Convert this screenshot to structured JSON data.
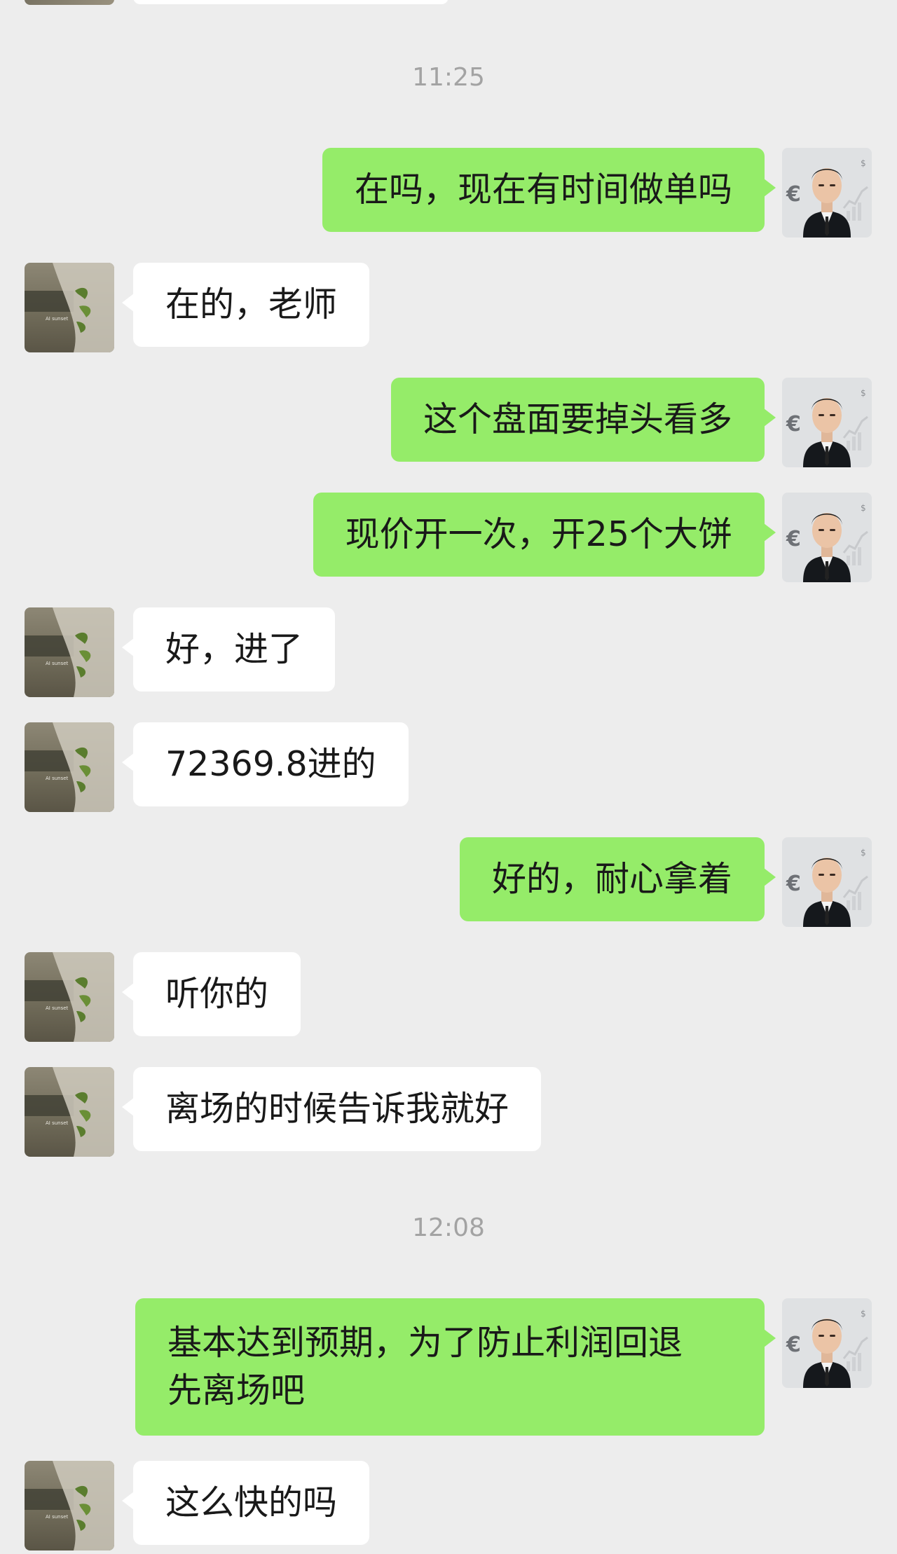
{
  "chat": {
    "timestamps": [
      "11:25",
      "12:08"
    ],
    "avatars": {
      "me": {
        "name": "advisor-avatar",
        "icons": [
          "euro-icon",
          "dollar-icon",
          "chart-icon"
        ],
        "colors": {
          "bg": "#dfe1e3",
          "suit": "#111418"
        }
      },
      "other": {
        "name": "contact-avatar",
        "watermark": "AI sunset",
        "colors": {
          "bg": "#6f6a58",
          "leaf": "#5a7d2e"
        }
      }
    },
    "messages": [
      {
        "from": "me",
        "text": "在吗，现在有时间做单吗"
      },
      {
        "from": "other",
        "text": "在的，老师"
      },
      {
        "from": "me",
        "text": "这个盘面要掉头看多"
      },
      {
        "from": "me",
        "text": "现价开一次，开25个大饼"
      },
      {
        "from": "other",
        "text": "好，进了"
      },
      {
        "from": "other",
        "text": "72369.8进的"
      },
      {
        "from": "me",
        "text": "好的，耐心拿着"
      },
      {
        "from": "other",
        "text": "听你的"
      },
      {
        "from": "other",
        "text": "离场的时候告诉我就好"
      },
      {
        "from": "me",
        "lines": [
          "基本达到预期，为了防止利润回退",
          "先离场吧"
        ]
      },
      {
        "from": "other",
        "text": "这么快的吗"
      }
    ]
  },
  "colors": {
    "background": "#ededed",
    "my_bubble": "#95ec69",
    "their_bubble": "#ffffff",
    "timestamp_text": "#a3a3a3",
    "message_text": "#191919"
  }
}
